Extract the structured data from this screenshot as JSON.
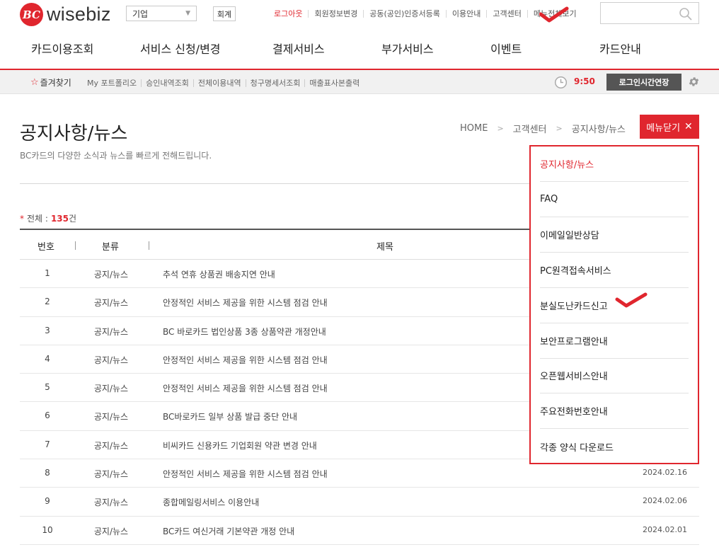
{
  "brand": {
    "logo_mark": "BC",
    "logo_text": "wisebiz"
  },
  "top": {
    "biz_select": "기업",
    "acct_button": "회계",
    "links": [
      {
        "label": "로그아웃",
        "accent": true
      },
      {
        "label": "회원정보변경"
      },
      {
        "label": "공동(공인)인증서등록"
      },
      {
        "label": "이용안내"
      },
      {
        "label": "고객센터"
      },
      {
        "label": "메뉴전체보기"
      }
    ],
    "search_placeholder": ""
  },
  "nav": [
    "카드이용조회",
    "서비스 신청/변경",
    "결제서비스",
    "부가서비스",
    "이벤트",
    "카드안내"
  ],
  "quick": {
    "favorites": "즐겨찾기",
    "links": [
      "My 포트폴리오",
      "승인내역조회",
      "전체이용내역",
      "청구명세서조회",
      "매출표사본출력"
    ],
    "timer": "9:50",
    "extend": "로그인시간연장"
  },
  "page": {
    "title": "공지사항/뉴스",
    "subtitle": "BC카드의 다양한 소식과 뉴스를 빠르게 전해드립니다.",
    "breadcrumb": [
      "HOME",
      "고객센터",
      "공지사항/뉴스"
    ],
    "menu_close": "메뉴닫기",
    "total_label": "전체 :",
    "total_count": "135",
    "total_unit": "건"
  },
  "table": {
    "headers": {
      "no": "번호",
      "category": "분류",
      "title": "제목"
    },
    "rows": [
      {
        "no": "1",
        "category": "공지/뉴스",
        "title": "추석 연휴 상품권 배송지연 안내",
        "date": ""
      },
      {
        "no": "2",
        "category": "공지/뉴스",
        "title": "안정적인 서비스 제공을 위한 시스템 점검 안내",
        "date": ""
      },
      {
        "no": "3",
        "category": "공지/뉴스",
        "title": "BC 바로카드 법인상품 3종 상품약관 개정안내",
        "date": ""
      },
      {
        "no": "4",
        "category": "공지/뉴스",
        "title": "안정적인 서비스 제공을 위한 시스템 점검 안내",
        "date": ""
      },
      {
        "no": "5",
        "category": "공지/뉴스",
        "title": "안정적인 서비스 제공을 위한 시스템 점검 안내",
        "date": ""
      },
      {
        "no": "6",
        "category": "공지/뉴스",
        "title": "BC바로카드 일부 상품 발급 중단 안내",
        "date": ""
      },
      {
        "no": "7",
        "category": "공지/뉴스",
        "title": "비씨카드 신용카드 기업회원 약관 변경 안내",
        "date": ""
      },
      {
        "no": "8",
        "category": "공지/뉴스",
        "title": "안정적인 서비스 제공을 위한 시스템 점검 안내",
        "date": "2024.02.16"
      },
      {
        "no": "9",
        "category": "공지/뉴스",
        "title": "종합메일링서비스 이용안내",
        "date": "2024.02.06"
      },
      {
        "no": "10",
        "category": "공지/뉴스",
        "title": "BC카드 여신거래 기본약관 개정 안내",
        "date": "2024.02.01"
      }
    ]
  },
  "side_menu": {
    "items": [
      {
        "label": "공지사항/뉴스",
        "active": true
      },
      {
        "label": "FAQ"
      },
      {
        "label": "이메일일반상담"
      },
      {
        "label": "PC원격접속서비스"
      },
      {
        "label": "분실도난카드신고"
      },
      {
        "label": "보안프로그램안내"
      },
      {
        "label": "오픈웹서비스안내"
      },
      {
        "label": "주요전화번호안내"
      },
      {
        "label": "각종 양식 다운로드"
      }
    ]
  },
  "colors": {
    "accent": "#e0262e",
    "dark_button": "#555555"
  },
  "icons": [
    "search-icon",
    "star-icon",
    "clock-icon",
    "gear-icon",
    "close-icon",
    "chevron-down-icon",
    "checkmark-icon"
  ]
}
